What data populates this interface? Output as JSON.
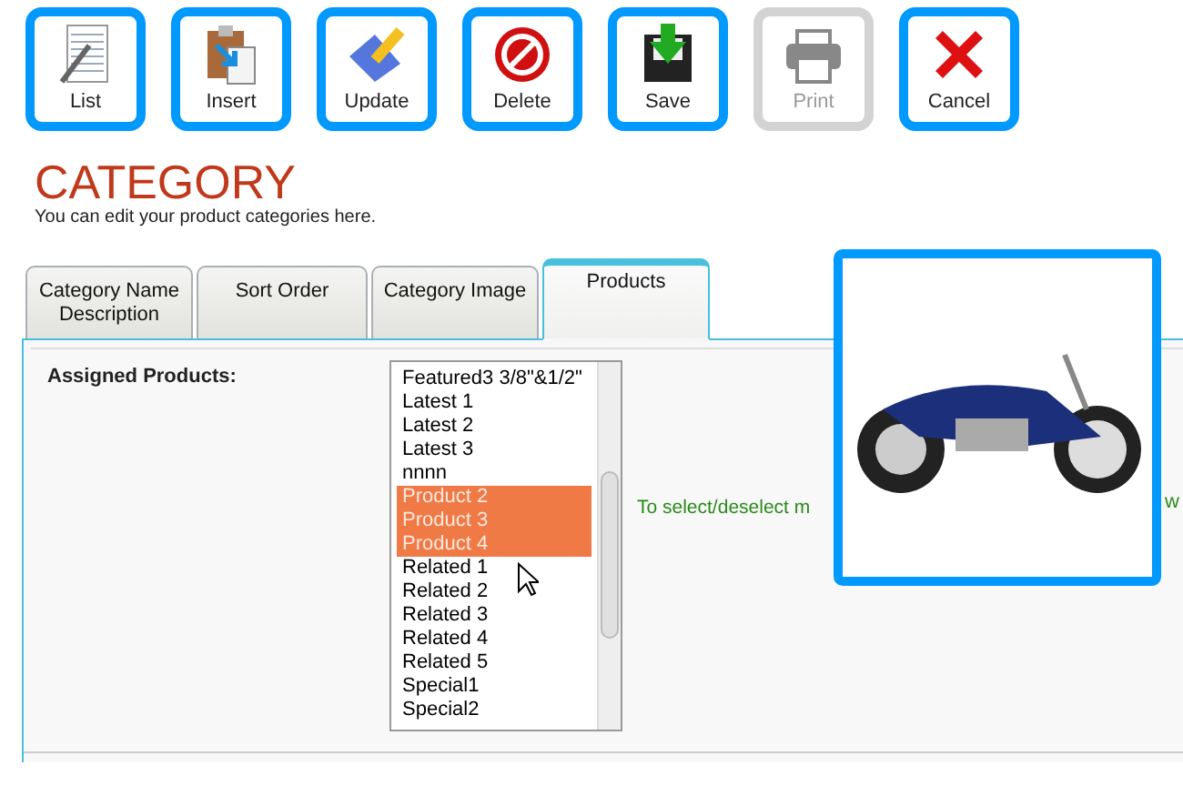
{
  "toolbar": [
    {
      "label": "List",
      "kind": "list",
      "disabled": false
    },
    {
      "label": "Insert",
      "kind": "insert",
      "disabled": false
    },
    {
      "label": "Update",
      "kind": "update",
      "disabled": false
    },
    {
      "label": "Delete",
      "kind": "delete",
      "disabled": false
    },
    {
      "label": "Save",
      "kind": "save",
      "disabled": false
    },
    {
      "label": "Print",
      "kind": "print",
      "disabled": true
    },
    {
      "label": "Cancel",
      "kind": "cancel",
      "disabled": false
    }
  ],
  "page": {
    "title": "CATEGORY",
    "subtitle": "You can edit your product categories here."
  },
  "tabs": [
    {
      "label": "Category Name Description",
      "selected": false
    },
    {
      "label": "Sort Order",
      "selected": false
    },
    {
      "label": "Category Image",
      "selected": false
    },
    {
      "label": "Products",
      "selected": true
    }
  ],
  "products_panel": {
    "label": "Assigned Products:",
    "items": [
      {
        "label": "Featured3 3/8\"&1/2\"",
        "selected": false
      },
      {
        "label": "Latest 1",
        "selected": false
      },
      {
        "label": "Latest 2",
        "selected": false
      },
      {
        "label": "Latest 3",
        "selected": false
      },
      {
        "label": "nnnn",
        "selected": false
      },
      {
        "label": "Product 2",
        "selected": true
      },
      {
        "label": "Product 3",
        "selected": true
      },
      {
        "label": "Product 4",
        "selected": true
      },
      {
        "label": "Related 1",
        "selected": false
      },
      {
        "label": "Related 2",
        "selected": false
      },
      {
        "label": "Related 3",
        "selected": false
      },
      {
        "label": "Related 4",
        "selected": false
      },
      {
        "label": "Related 5",
        "selected": false
      },
      {
        "label": "Special1",
        "selected": false
      },
      {
        "label": "Special2",
        "selected": false
      }
    ],
    "hint": "To select/deselect m",
    "hint_tail": "w"
  }
}
